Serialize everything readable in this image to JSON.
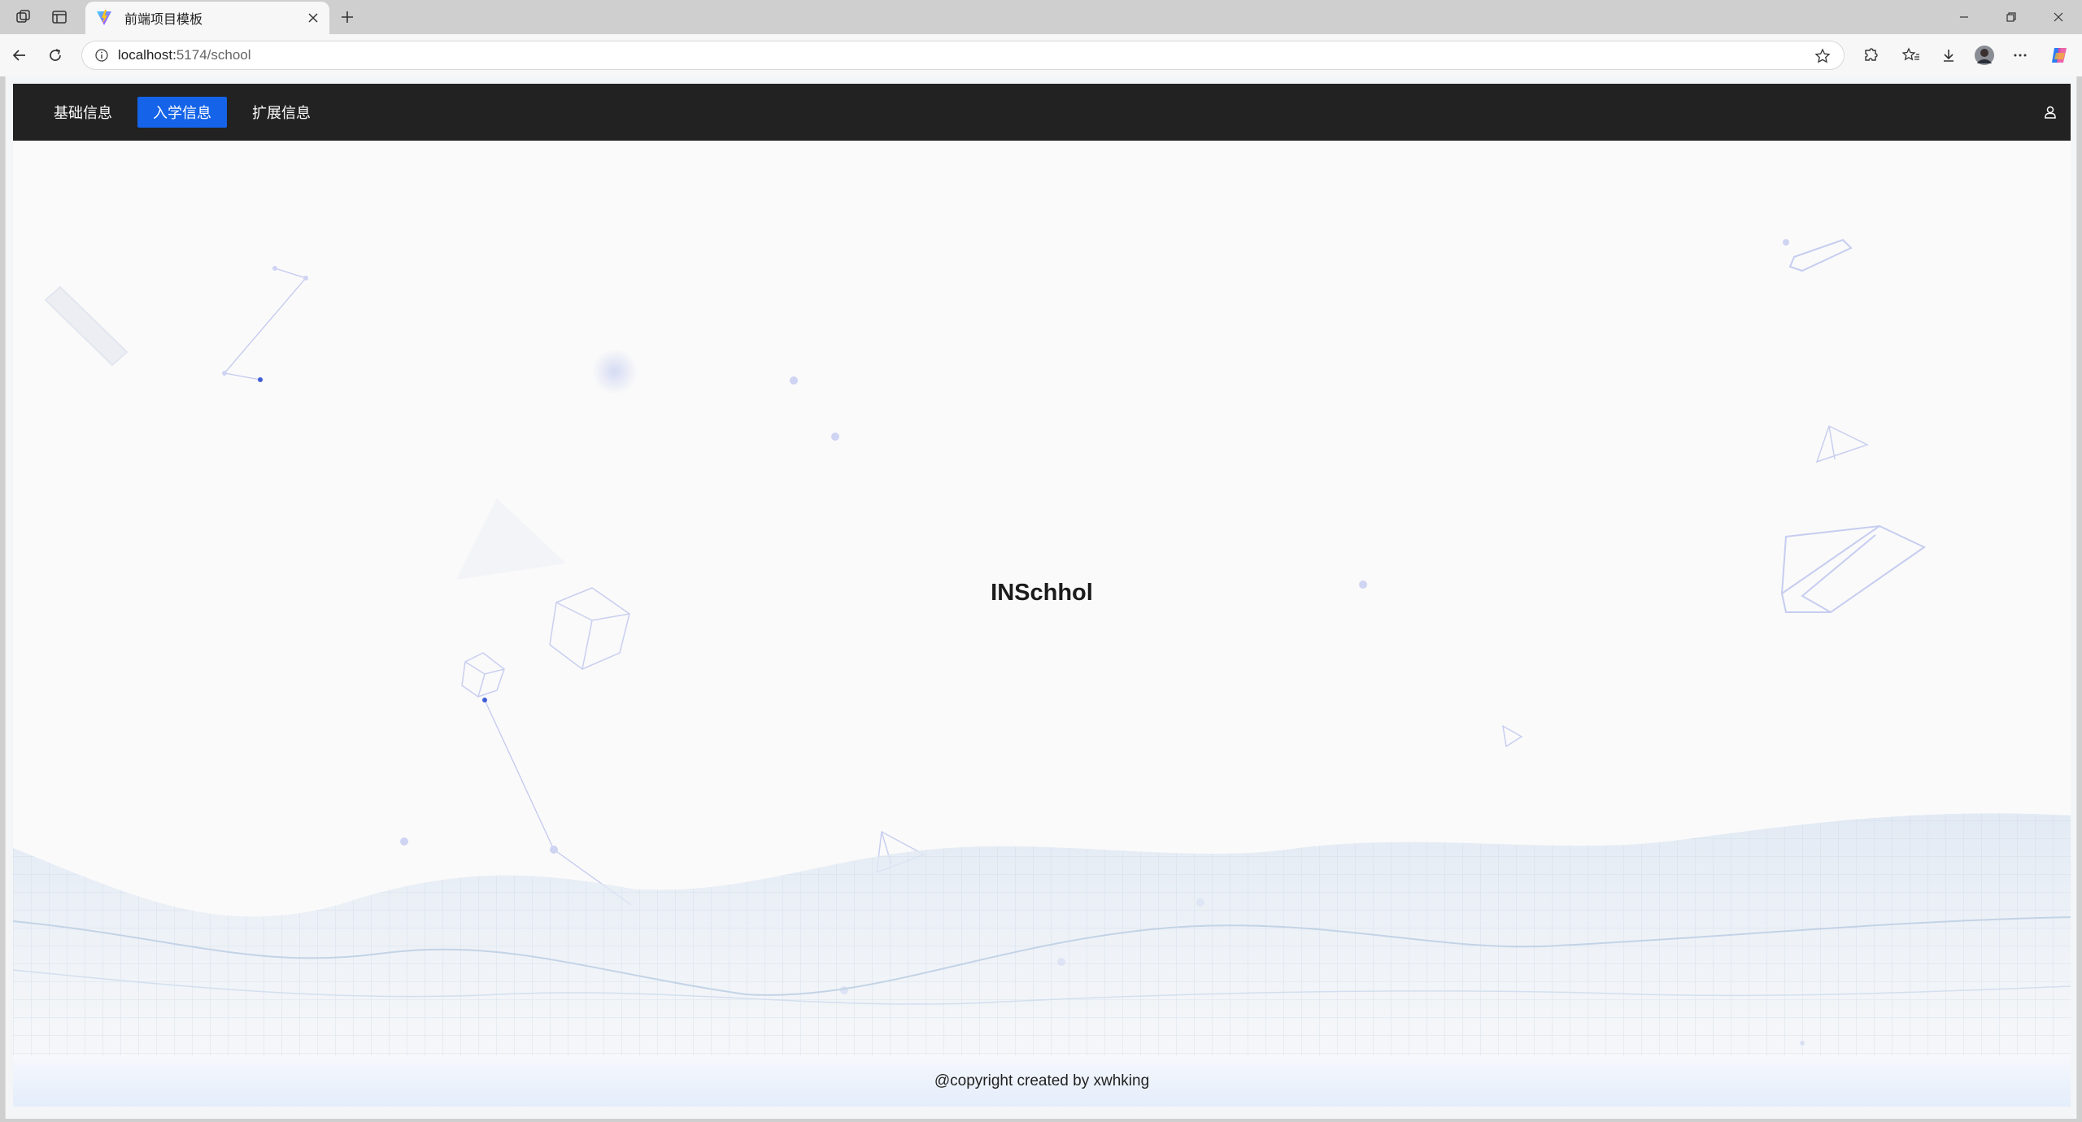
{
  "browser": {
    "tab_title": "前端项目模板",
    "url_host": "localhost:",
    "url_path": "5174/school"
  },
  "nav": {
    "items": [
      {
        "label": "基础信息",
        "active": false
      },
      {
        "label": "入学信息",
        "active": true
      },
      {
        "label": "扩展信息",
        "active": false
      }
    ],
    "user_icon": "user-icon"
  },
  "main": {
    "title": "INSchhol"
  },
  "footer": {
    "text": "@copyright created by xwhking"
  },
  "colors": {
    "navbar_bg": "#222222",
    "active_tab": "#1463e8",
    "page_bg": "#fafafa"
  }
}
